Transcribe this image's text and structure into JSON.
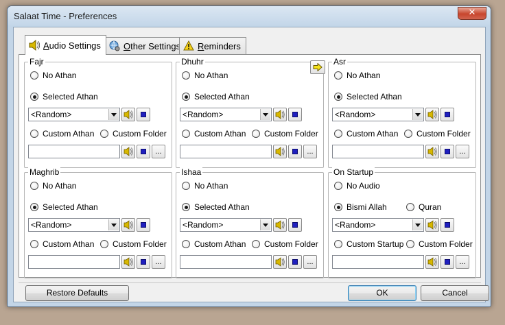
{
  "window": {
    "title": "Salaat Time - Preferences",
    "close_label": "✕"
  },
  "tabs": [
    {
      "label": "Audio Settings",
      "accesskey": "A",
      "rest": "udio Settings",
      "icon": "speaker-icon",
      "active": true
    },
    {
      "label": "Other Settings",
      "accesskey": "O",
      "rest": "ther Settings",
      "icon": "settings-globe-icon",
      "active": false
    },
    {
      "label": "Reminders",
      "accesskey": "R",
      "rest": "eminders",
      "icon": "warning-icon",
      "active": false
    }
  ],
  "groups": {
    "fajr": {
      "title": "Fajr",
      "opt1": "No Athan",
      "opt2": "Selected Athan",
      "combo": "<Random>",
      "opt3": "Custom Athan",
      "opt4": "Custom Folder"
    },
    "dhuhr": {
      "title": "Dhuhr",
      "opt1": "No Athan",
      "opt2": "Selected Athan",
      "combo": "<Random>",
      "opt3": "Custom Athan",
      "opt4": "Custom Folder"
    },
    "asr": {
      "title": "Asr",
      "opt1": "No Athan",
      "opt2": "Selected Athan",
      "combo": "<Random>",
      "opt3": "Custom Athan",
      "opt4": "Custom Folder"
    },
    "maghrib": {
      "title": "Maghrib",
      "opt1": "No Athan",
      "opt2": "Selected Athan",
      "combo": "<Random>",
      "opt3": "Custom Athan",
      "opt4": "Custom Folder"
    },
    "ishaa": {
      "title": "Ishaa",
      "opt1": "No Athan",
      "opt2": "Selected Athan",
      "combo": "<Random>",
      "opt3": "Custom Athan",
      "opt4": "Custom Folder"
    },
    "startup": {
      "title": "On Startup",
      "opt1": "No Audio",
      "opt2": "Bismi Allah",
      "opt2b": "Quran",
      "combo": "<Random>",
      "opt3": "Custom Startup",
      "opt4": "Custom Folder"
    }
  },
  "browse_label": "...",
  "buttons": {
    "restore": "Restore Defaults",
    "ok": "OK",
    "cancel": "Cancel"
  },
  "colors": {
    "stop": "#1f1fbf",
    "speaker": "#d8b800",
    "arrow": "#f4e21a"
  }
}
